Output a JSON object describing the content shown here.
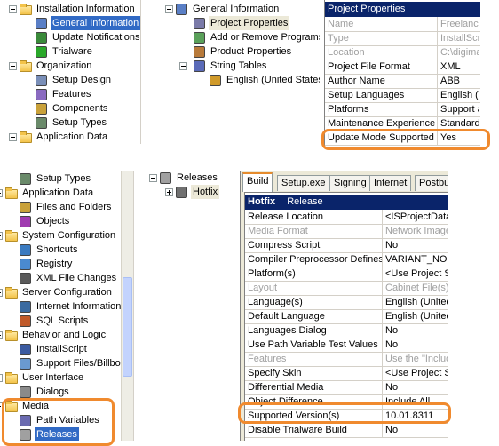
{
  "panel1": {
    "tree": [
      {
        "label": "Installation Information",
        "icon": "folder-icon",
        "exp": "minus"
      },
      {
        "label": "General Information",
        "icon": "general-info-icon",
        "sel": true
      },
      {
        "label": "Update Notifications",
        "icon": "update-icon"
      },
      {
        "label": "Trialware",
        "icon": "trialware-icon"
      },
      {
        "label": "Organization",
        "icon": "folder-icon",
        "exp": "minus"
      },
      {
        "label": "Setup Design",
        "icon": "setup-design-icon"
      },
      {
        "label": "Features",
        "icon": "features-icon"
      },
      {
        "label": "Components",
        "icon": "components-icon"
      },
      {
        "label": "Setup Types",
        "icon": "setup-types-icon"
      },
      {
        "label": "Application Data",
        "icon": "folder-icon",
        "exp": "minus"
      }
    ]
  },
  "panel2": {
    "tree": [
      {
        "label": "General Information",
        "icon": "general-info-icon",
        "exp": "minus"
      },
      {
        "label": "Project Properties",
        "icon": "project-properties-icon",
        "soft": true
      },
      {
        "label": "Add or Remove Programs",
        "icon": "add-remove-icon"
      },
      {
        "label": "Product Properties",
        "icon": "product-properties-icon"
      },
      {
        "label": "String Tables",
        "icon": "string-tables-icon",
        "exp": "minus"
      },
      {
        "label": "English (United States)",
        "icon": "language-icon"
      }
    ]
  },
  "panel3": {
    "header": "Project Properties",
    "rows": [
      {
        "name": "Name",
        "value": "Freelance",
        "gray": true
      },
      {
        "name": "Type",
        "value": "InstallScript",
        "gray": true
      },
      {
        "name": "Location",
        "value": "C:\\digima",
        "gray": true
      },
      {
        "name": "Project File Format",
        "value": "XML"
      },
      {
        "name": "Author Name",
        "value": "ABB"
      },
      {
        "name": "Setup Languages",
        "value": "English (U"
      },
      {
        "name": "Platforms",
        "value": "Support a"
      },
      {
        "name": "Maintenance Experience",
        "value": "Standard"
      },
      {
        "name": "Update Mode Supported",
        "value": "Yes"
      }
    ]
  },
  "panel4": {
    "tree": [
      {
        "label": "Setup Types",
        "icon": "setup-types-icon"
      },
      {
        "label": "Application Data",
        "icon": "folder-icon",
        "exp": "minus"
      },
      {
        "label": "Files and Folders",
        "icon": "files-folders-icon"
      },
      {
        "label": "Objects",
        "icon": "objects-icon"
      },
      {
        "label": "System Configuration",
        "icon": "folder-icon",
        "exp": "minus"
      },
      {
        "label": "Shortcuts",
        "icon": "shortcuts-icon"
      },
      {
        "label": "Registry",
        "icon": "registry-icon"
      },
      {
        "label": "XML File Changes",
        "icon": "xml-icon"
      },
      {
        "label": "Server Configuration",
        "icon": "folder-icon",
        "exp": "minus"
      },
      {
        "label": "Internet Information",
        "icon": "iis-icon"
      },
      {
        "label": "SQL Scripts",
        "icon": "sql-icon"
      },
      {
        "label": "Behavior and Logic",
        "icon": "folder-icon",
        "exp": "minus"
      },
      {
        "label": "InstallScript",
        "icon": "installscript-icon"
      },
      {
        "label": "Support Files/Billboards",
        "icon": "support-files-icon"
      },
      {
        "label": "User Interface",
        "icon": "folder-icon",
        "exp": "minus"
      },
      {
        "label": "Dialogs",
        "icon": "dialogs-icon"
      },
      {
        "label": "Media",
        "icon": "folder-icon",
        "exp": "minus"
      },
      {
        "label": "Path Variables",
        "icon": "path-variables-icon"
      },
      {
        "label": "Releases",
        "icon": "releases-icon",
        "sel": true
      }
    ]
  },
  "panel5": {
    "tree": [
      {
        "label": "Releases",
        "icon": "releases-icon",
        "exp": "minus"
      },
      {
        "label": "Hotfix",
        "icon": "hotfix-icon",
        "exp": "plus",
        "soft": true
      }
    ]
  },
  "panel6": {
    "tabs": [
      "Build",
      "Setup.exe",
      "Signing",
      "Internet",
      "Postbuild"
    ],
    "header_bold": "Hotfix",
    "header_rest": "Release",
    "rows": [
      {
        "name": "Release Location",
        "value": "<ISProjectDataFolder>"
      },
      {
        "name": "Media Format",
        "value": "Network Image",
        "gray": true
      },
      {
        "name": "Compress Script",
        "value": "No"
      },
      {
        "name": "Compiler Preprocessor Defines",
        "value": "VARIANT_NON"
      },
      {
        "name": "Platform(s)",
        "value": "<Use Project S"
      },
      {
        "name": "Layout",
        "value": "Cabinet File(s)",
        "gray": true
      },
      {
        "name": "Language(s)",
        "value": "English (United"
      },
      {
        "name": "Default Language",
        "value": "English (United"
      },
      {
        "name": "Languages Dialog",
        "value": "No"
      },
      {
        "name": "Use Path Variable Test Values",
        "value": "No"
      },
      {
        "name": "Features",
        "value": "Use the \"Include",
        "gray": true
      },
      {
        "name": "Specify Skin",
        "value": "<Use Project S"
      },
      {
        "name": "Differential Media",
        "value": "No"
      },
      {
        "name": "Object Difference",
        "value": "Include All"
      },
      {
        "name": "Supported Version(s)",
        "value": "10.01.8311"
      },
      {
        "name": "Disable Trialware Build",
        "value": "No"
      }
    ]
  },
  "colors": {
    "highlight": "#f08a2e",
    "selection": "#316ac5",
    "grid_header": "#0a246a"
  }
}
